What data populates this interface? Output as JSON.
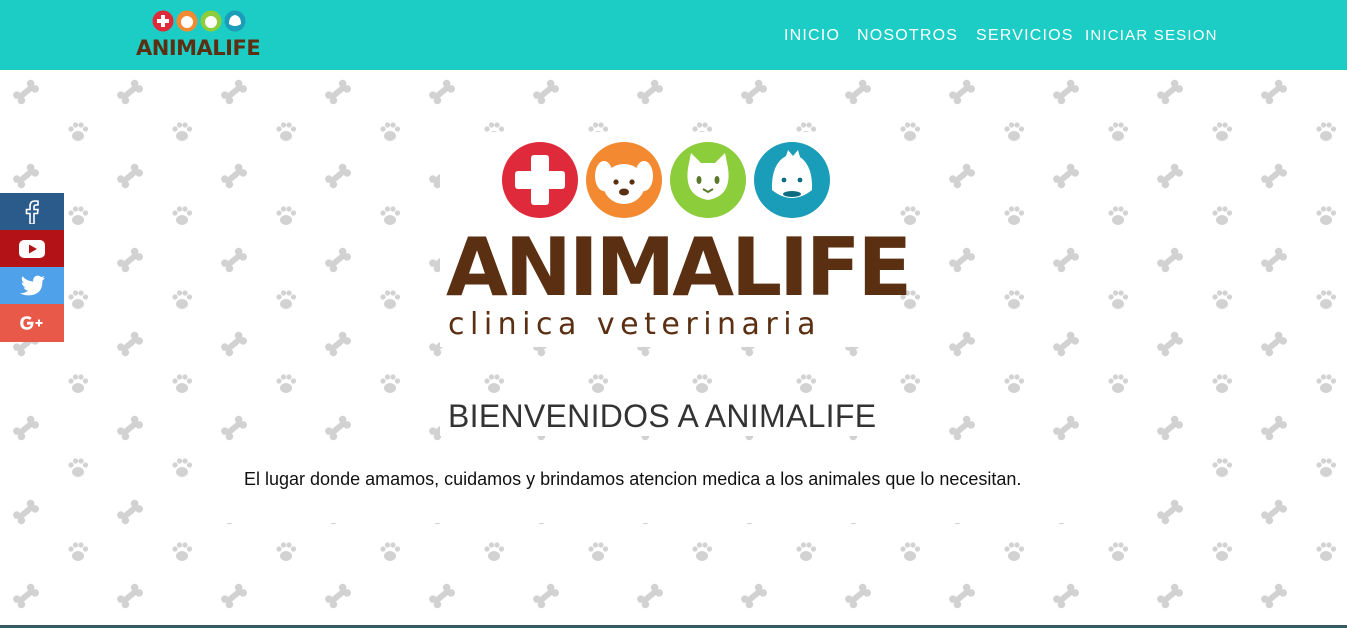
{
  "header": {
    "logo_text": "ANIMALIFE",
    "nav": [
      {
        "label": "INICIO"
      },
      {
        "label": "NOSOTROS"
      },
      {
        "label": "SERVICIOS"
      },
      {
        "label": "INICIAR SESION"
      }
    ]
  },
  "hero": {
    "logo_text": "ANIMALIFE",
    "logo_subtitle": "clinica veterinaria",
    "title": "BIENVENIDOS A ANIMALIFE",
    "description": "El lugar donde amamos, cuidamos y brindamos atencion medica a los animales que lo necesitan."
  },
  "social": {
    "items": [
      {
        "name": "facebook",
        "color": "#2b5b8a"
      },
      {
        "name": "youtube",
        "color": "#b31217"
      },
      {
        "name": "twitter",
        "color": "#4fa1ea"
      },
      {
        "name": "google-plus",
        "color": "#e8594a"
      }
    ]
  },
  "colors": {
    "header": "#1ccdc5",
    "brand_brown": "#5a2f12",
    "icon_red": "#df2a3b",
    "icon_orange": "#f38a32",
    "icon_green": "#8ccd3b",
    "icon_teal": "#1a9db8"
  }
}
